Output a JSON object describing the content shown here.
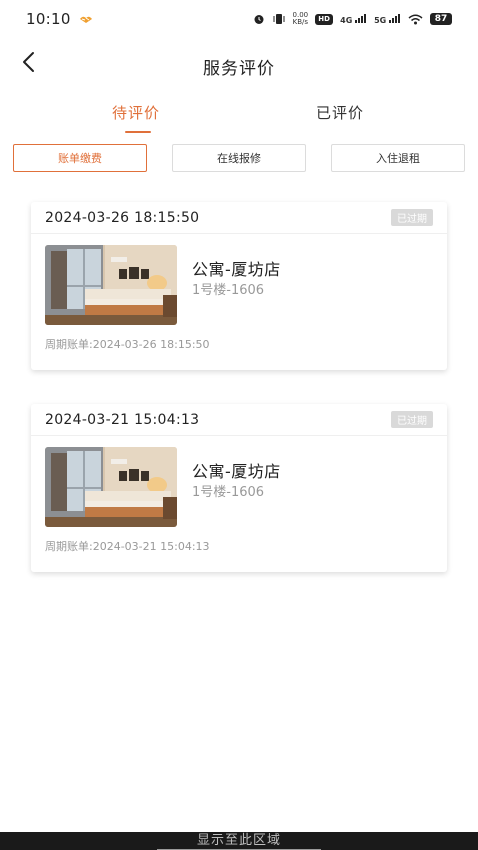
{
  "status_bar": {
    "time": "10:10",
    "netspeed_value": "0.00",
    "netspeed_unit": "KB/s",
    "hd_label": "HD",
    "signal_4g": "4G",
    "signal_5g": "5G",
    "battery": "87"
  },
  "nav": {
    "title": "服务评价"
  },
  "tabs": [
    {
      "label": "待评价",
      "active": true
    },
    {
      "label": "已评价",
      "active": false
    }
  ],
  "filters": [
    {
      "label": "账单缴费",
      "selected": true
    },
    {
      "label": "在线报修",
      "selected": false
    },
    {
      "label": "入住退租",
      "selected": false
    }
  ],
  "cards": [
    {
      "date": "2024-03-26 18:15:50",
      "badge": "已过期",
      "room_name": "公寓-厦坊店",
      "room_unit": "1号楼-1606",
      "bill": "周期账单:2024-03-26 18:15:50"
    },
    {
      "date": "2024-03-21 15:04:13",
      "badge": "已过期",
      "room_name": "公寓-厦坊店",
      "room_unit": "1号楼-1606",
      "bill": "周期账单:2024-03-21 15:04:13"
    }
  ],
  "bottom_bar": {
    "text": "显示至此区域"
  },
  "colors": {
    "accent": "#e0703a",
    "badge_bg": "#d9d9d9",
    "muted_text": "#999999"
  },
  "icons": [
    "back-arrow-icon",
    "alarm-icon",
    "vibrate-icon",
    "wifi-icon",
    "heart-icon"
  ]
}
